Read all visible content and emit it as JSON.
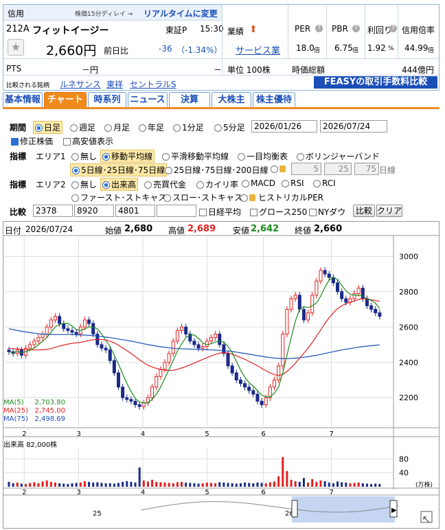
{
  "header": {
    "credit_label": "信用",
    "delay_note": "株価15分ディレイ →",
    "realtime_link": "リアルタイムに変更",
    "code": "212A",
    "name": "フィットイージー",
    "market": "東証P",
    "time": "15:30",
    "price": "2,660円",
    "prev_label": "前日比",
    "change": "-36",
    "change_pct": "（-1.34%）",
    "pts_label": "PTS",
    "pts_value": "－円",
    "pts_change": "－",
    "compare_label": "比較される銘柄",
    "compare_links": [
      "ルネサンス",
      "東祥",
      "セントラルS"
    ],
    "perf_label": "業績",
    "sector": "サービス業",
    "unit": "単位 100株",
    "per_label": "PER",
    "per_value": "18.0",
    "pbr_label": "PBR",
    "pbr_value": "6.75",
    "yield_label": "利回り",
    "yield_value": "1.92",
    "credit_ratio_label": "信用倍率",
    "credit_ratio_value": "44.99",
    "unit_times": "倍",
    "unit_pct": "%",
    "mcap_label": "時価総額",
    "mcap_value": "444億円",
    "ad": "FEASYの取引手数料比較",
    "colors": {
      "down": "#1a4fb8",
      "up": "#e02020",
      "accent": "#f08a1c"
    }
  },
  "tabs": [
    "基本情報",
    "チャート",
    "時系列",
    "ニュース",
    "決算",
    "大株主",
    "株主優待"
  ],
  "controls": {
    "period_label": "期間",
    "periods": [
      "日足",
      "週足",
      "月足",
      "年足",
      "1分足",
      "5分足"
    ],
    "date_from": "2026/01/26",
    "date_to": "2026/07/24",
    "adjusted": "修正株価",
    "hilo": "高安値表示",
    "indicator_label": "指標",
    "area1": "エリア1",
    "area1_options": [
      "無し",
      "移動平均線",
      "平滑移動平均線",
      "一目均衡表",
      "ボリンジャーバンド"
    ],
    "ma_options": [
      "5日線･25日線･75日線",
      "25日線･75日線･200日線"
    ],
    "ma_custom": [
      "5",
      "25",
      "75"
    ],
    "ma_custom_unit": "日線",
    "area2": "エリア2",
    "area2_options": [
      "無し",
      "出来高",
      "売買代金",
      "カイリ率",
      "MACD",
      "RSI",
      "RCI"
    ],
    "area2_options_b": [
      "ファースト･ストキャス",
      "スロー･ストキャス",
      "ヒストリカルPER"
    ],
    "compare_label": "比較",
    "compare_codes": [
      "2378",
      "8920",
      "4801",
      ""
    ],
    "compare_checks": [
      "日経平均",
      "グロース250",
      "NYダウ"
    ],
    "compare_btn": "比較",
    "clear_btn": "クリア"
  },
  "chart_info": {
    "date_label": "日付",
    "date": "2026/07/24",
    "open_label": "始値",
    "open": "2,680",
    "high_label": "高値",
    "high": "2,689",
    "low_label": "安値",
    "low": "2,642",
    "close_label": "終値",
    "close": "2,660",
    "ma5": "MA(5)",
    "ma5_value": "2,703.80",
    "ma25": "MA(25)",
    "ma25_value": "2,745.00",
    "ma75": "MA(75)",
    "ma75_value": "2,498.69",
    "volume_label": "出来高",
    "volume_value": "82,000株",
    "volume_unit": "(万株)"
  },
  "chart_data": {
    "type": "candlestick",
    "x_labels": [
      "2",
      "3",
      "4",
      "5",
      "6",
      "7"
    ],
    "y_ticks": [
      2200,
      2400,
      2600,
      2800,
      3000
    ],
    "ylim": [
      2030,
      3110
    ],
    "volume_ticks": [
      40,
      80
    ],
    "volume_ylim": [
      0,
      110
    ],
    "navigator_labels": [
      "25",
      "26"
    ],
    "closes": [
      2460,
      2450,
      2470,
      2440,
      2480,
      2500,
      2520,
      2540,
      2560,
      2600,
      2640,
      2660,
      2620,
      2590,
      2580,
      2570,
      2560,
      2600,
      2640,
      2620,
      2560,
      2500,
      2480,
      2470,
      2410,
      2340,
      2260,
      2200,
      2190,
      2180,
      2160,
      2150,
      2170,
      2200,
      2260,
      2320,
      2360,
      2400,
      2450,
      2520,
      2580,
      2600,
      2560,
      2520,
      2500,
      2480,
      2490,
      2520,
      2540,
      2560,
      2500,
      2450,
      2380,
      2340,
      2300,
      2280,
      2260,
      2240,
      2220,
      2180,
      2160,
      2200,
      2260,
      2300,
      2380,
      2560,
      2700,
      2760,
      2780,
      2700,
      2640,
      2680,
      2780,
      2860,
      2920,
      2900,
      2880,
      2850,
      2800,
      2760,
      2740,
      2760,
      2790,
      2820,
      2760,
      2720,
      2700,
      2680,
      2660
    ],
    "ma5": [
      2460,
      2455,
      2460,
      2455,
      2460,
      2470,
      2480,
      2500,
      2520,
      2540,
      2570,
      2600,
      2615,
      2620,
      2620,
      2605,
      2585,
      2580,
      2590,
      2600,
      2600,
      2590,
      2560,
      2525,
      2490,
      2440,
      2390,
      2335,
      2280,
      2235,
      2195,
      2175,
      2170,
      2172,
      2190,
      2220,
      2260,
      2310,
      2360,
      2410,
      2465,
      2505,
      2540,
      2555,
      2555,
      2535,
      2510,
      2500,
      2505,
      2515,
      2520,
      2515,
      2490,
      2455,
      2405,
      2355,
      2315,
      2285,
      2265,
      2240,
      2215,
      2205,
      2205,
      2225,
      2260,
      2340,
      2440,
      2540,
      2635,
      2700,
      2715,
      2710,
      2720,
      2735,
      2775,
      2825,
      2865,
      2880,
      2870,
      2835,
      2805,
      2785,
      2780,
      2780,
      2775,
      2760,
      2750,
      2735,
      2704
    ],
    "ma25": [
      2480,
      2478,
      2476,
      2474,
      2472,
      2471,
      2470,
      2470,
      2471,
      2473,
      2478,
      2485,
      2492,
      2498,
      2503,
      2507,
      2510,
      2513,
      2518,
      2524,
      2528,
      2530,
      2529,
      2526,
      2520,
      2510,
      2497,
      2482,
      2466,
      2450,
      2432,
      2414,
      2398,
      2384,
      2373,
      2366,
      2360,
      2356,
      2354,
      2355,
      2360,
      2368,
      2376,
      2386,
      2396,
      2406,
      2416,
      2426,
      2436,
      2445,
      2452,
      2455,
      2453,
      2446,
      2437,
      2427,
      2417,
      2405,
      2393,
      2380,
      2366,
      2353,
      2340,
      2330,
      2326,
      2332,
      2348,
      2370,
      2396,
      2424,
      2452,
      2480,
      2512,
      2548,
      2584,
      2620,
      2652,
      2680,
      2704,
      2720,
      2732,
      2740,
      2748,
      2756,
      2760,
      2758,
      2754,
      2750,
      2745
    ],
    "ma75": [
      2590,
      2585,
      2580,
      2576,
      2572,
      2568,
      2565,
      2562,
      2560,
      2559,
      2558,
      2557,
      2557,
      2557,
      2557,
      2557,
      2556,
      2555,
      2554,
      2553,
      2551,
      2549,
      2546,
      2543,
      2540,
      2536,
      2532,
      2528,
      2524,
      2520,
      2515,
      2510,
      2505,
      2500,
      2496,
      2492,
      2488,
      2485,
      2482,
      2480,
      2478,
      2477,
      2476,
      2475,
      2474,
      2473,
      2472,
      2471,
      2470,
      2469,
      2468,
      2466,
      2464,
      2461,
      2458,
      2454,
      2450,
      2446,
      2442,
      2438,
      2434,
      2430,
      2427,
      2424,
      2422,
      2421,
      2421,
      2422,
      2424,
      2426,
      2429,
      2432,
      2436,
      2440,
      2445,
      2450,
      2455,
      2460,
      2465,
      2470,
      2474,
      2478,
      2482,
      2486,
      2489,
      2492,
      2494,
      2496,
      2499
    ],
    "volumes": [
      14,
      10,
      12,
      9,
      8,
      11,
      13,
      10,
      15,
      18,
      14,
      12,
      10,
      9,
      8,
      10,
      11,
      12,
      16,
      14,
      12,
      13,
      11,
      10,
      10,
      9,
      11,
      14,
      16,
      14,
      12,
      55,
      18,
      15,
      20,
      14,
      13,
      12,
      11,
      10,
      13,
      14,
      12,
      11,
      10,
      9,
      10,
      12,
      11,
      10,
      13,
      12,
      11,
      10,
      9,
      10,
      12,
      11,
      10,
      12,
      11,
      10,
      13,
      15,
      30,
      85,
      45,
      20,
      16,
      14,
      25,
      12,
      22,
      14,
      18,
      16,
      12,
      10,
      15,
      13,
      12,
      10,
      11,
      12,
      10,
      9,
      8,
      9,
      8
    ]
  }
}
